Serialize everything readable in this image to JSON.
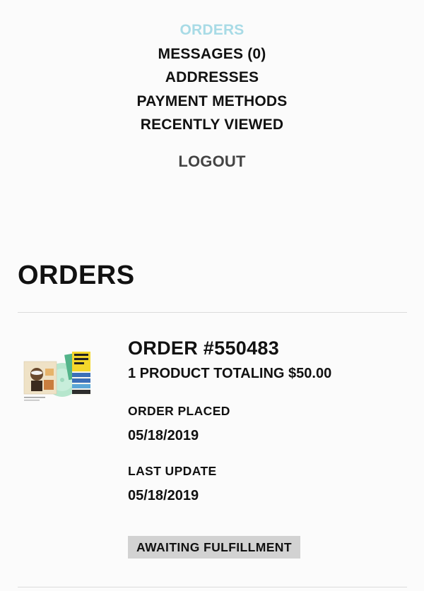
{
  "nav": {
    "items": [
      {
        "label": "ORDERS",
        "active": true
      },
      {
        "label": "MESSAGES (0)",
        "active": false
      },
      {
        "label": "ADDRESSES",
        "active": false
      },
      {
        "label": "PAYMENT METHODS",
        "active": false
      },
      {
        "label": "RECENTLY VIEWED",
        "active": false
      }
    ],
    "logout": "LOGOUT",
    "active_color": "#a8dbe6"
  },
  "page": {
    "title": "ORDERS"
  },
  "orders": [
    {
      "number": "ORDER #550483",
      "summary": "1 PRODUCT TOTALING $50.00",
      "placed_label": "ORDER PLACED",
      "placed_date": "05/18/2019",
      "update_label": "LAST UPDATE",
      "update_date": "05/18/2019",
      "status": "AWAITING FULFILLMENT",
      "thumbnail": "product-thumbnail-image"
    }
  ]
}
